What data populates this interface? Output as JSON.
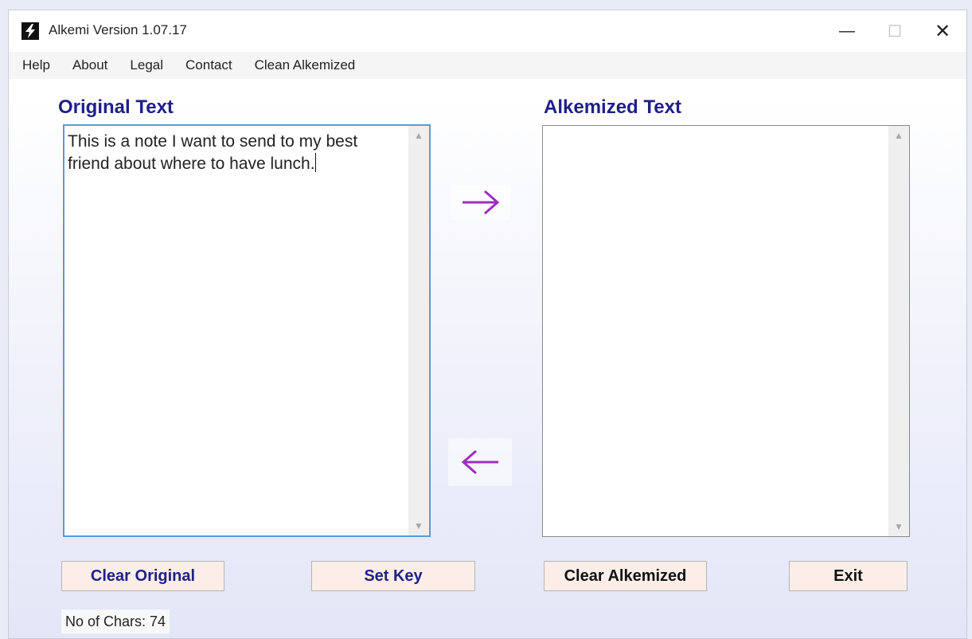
{
  "window": {
    "title": "Alkemi Version 1.07.17",
    "controls": {
      "minimize": "—",
      "maximize": "☐",
      "close": "✕"
    }
  },
  "menu": [
    {
      "label": "Help"
    },
    {
      "label": "About"
    },
    {
      "label": "Legal"
    },
    {
      "label": "Contact"
    },
    {
      "label": "Clean Alkemized"
    }
  ],
  "original": {
    "heading": "Original Text",
    "text": "This is a note I want to send to my best\nfriend about where to have lunch."
  },
  "alkemized": {
    "heading": "Alkemized Text",
    "text": ""
  },
  "arrows": {
    "encode_icon": "arrow-right",
    "decode_icon": "arrow-left",
    "color": "#9c2fbf"
  },
  "buttons": {
    "clear_original": "Clear Original",
    "set_key": "Set Key",
    "clear_alkemized": "Clear Alkemized",
    "exit": "Exit"
  },
  "status": {
    "char_count": "No of Chars: 74"
  },
  "colors": {
    "heading": "#1f1f8a",
    "button_bg": "#fbeee8",
    "focus_border": "#5a9bd4"
  }
}
